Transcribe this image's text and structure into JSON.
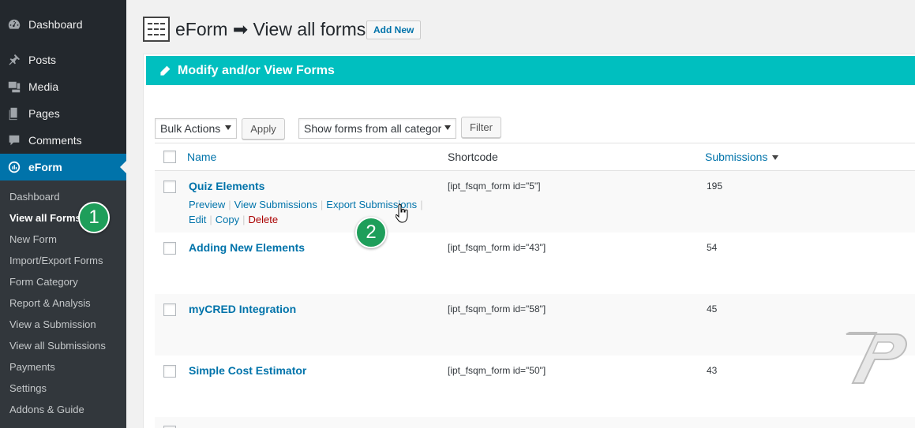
{
  "sidebar": {
    "items": [
      {
        "label": "Dashboard",
        "icon": "dashboard-icon"
      },
      {
        "label": "Posts",
        "icon": "pin-icon"
      },
      {
        "label": "Media",
        "icon": "media-icon"
      },
      {
        "label": "Pages",
        "icon": "pages-icon"
      },
      {
        "label": "Comments",
        "icon": "comments-icon"
      },
      {
        "label": "eForm",
        "icon": "eform-icon"
      }
    ],
    "submenu": [
      "Dashboard",
      "View all Forms",
      "New Form",
      "Import/Export Forms",
      "Form Category",
      "Report & Analysis",
      "View a Submission",
      "View all Submissions",
      "Payments",
      "Settings",
      "Addons & Guide"
    ]
  },
  "badges": {
    "one": "1",
    "two": "2"
  },
  "header": {
    "title": "eForm ➡ View all forms",
    "add_new": "Add New"
  },
  "panel": {
    "title": "Modify and/or View Forms"
  },
  "controls": {
    "bulk_actions": "Bulk Actions",
    "apply": "Apply",
    "category_filter": "Show forms from all categories",
    "filter": "Filter"
  },
  "table": {
    "columns": {
      "name": "Name",
      "shortcode": "Shortcode",
      "submissions": "Submissions"
    },
    "row_actions": {
      "preview": "Preview",
      "view_submissions": "View Submissions",
      "export_submissions": "Export Submissions",
      "edit": "Edit",
      "copy": "Copy",
      "delete": "Delete"
    },
    "rows": [
      {
        "name": "Quiz Elements",
        "shortcode": "[ipt_fsqm_form id=\"5\"]",
        "submissions": "195"
      },
      {
        "name": "Adding New Elements",
        "shortcode": "[ipt_fsqm_form id=\"43\"]",
        "submissions": "54"
      },
      {
        "name": "myCRED Integration",
        "shortcode": "[ipt_fsqm_form id=\"58\"]",
        "submissions": "45"
      },
      {
        "name": "Simple Cost Estimator",
        "shortcode": "[ipt_fsqm_form id=\"50\"]",
        "submissions": "43"
      }
    ]
  },
  "colors": {
    "sidebar": "#23282d",
    "submenu": "#32373c",
    "accent": "#0073aa",
    "panel_header": "#00bfbf",
    "badge": "#1e9e5a"
  }
}
